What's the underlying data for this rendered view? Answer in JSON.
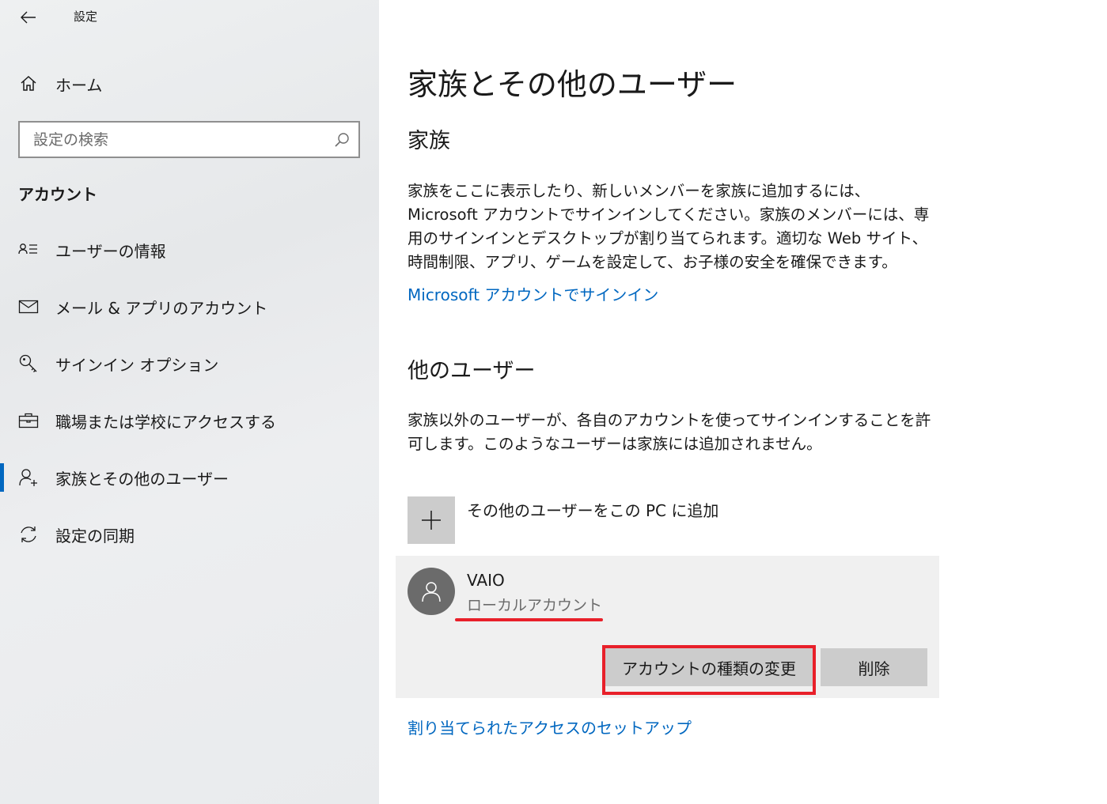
{
  "window": {
    "title": "設定"
  },
  "sidebar": {
    "home_label": "ホーム",
    "search": {
      "placeholder": "設定の検索",
      "value": ""
    },
    "section_title": "アカウント",
    "items": [
      {
        "label": "ユーザーの情報",
        "icon": "user-info-icon",
        "selected": false
      },
      {
        "label": "メール & アプリのアカウント",
        "icon": "mail-icon",
        "selected": false
      },
      {
        "label": "サインイン オプション",
        "icon": "key-icon",
        "selected": false
      },
      {
        "label": "職場または学校にアクセスする",
        "icon": "briefcase-icon",
        "selected": false
      },
      {
        "label": "家族とその他のユーザー",
        "icon": "add-person-icon",
        "selected": true
      },
      {
        "label": "設定の同期",
        "icon": "sync-icon",
        "selected": false
      }
    ]
  },
  "main": {
    "title": "家族とその他のユーザー",
    "family": {
      "heading": "家族",
      "description": "家族をここに表示したり、新しいメンバーを家族に追加するには、Microsoft アカウントでサインインしてください。家族のメンバーには、専用のサインインとデスクトップが割り当てられます。適切な Web サイト、時間制限、アプリ、ゲームを設定して、お子様の安全を確保できます。",
      "signin_link": "Microsoft アカウントでサインイン"
    },
    "other_users": {
      "heading": "他のユーザー",
      "description": "家族以外のユーザーが、各自のアカウントを使ってサインインすることを許可します。このようなユーザーは家族には追加されません。",
      "add_label": "その他のユーザーをこの PC に追加",
      "user": {
        "name": "VAIO",
        "account_type": "ローカルアカウント",
        "change_type_label": "アカウントの種類の変更",
        "delete_label": "削除"
      }
    },
    "assigned_access_link": "割り当てられたアクセスのセットアップ"
  },
  "colors": {
    "accent": "#0067c0",
    "annotation_red": "#e8202a",
    "button_gray": "#cccccc",
    "card_bg": "#f0f0f0"
  }
}
